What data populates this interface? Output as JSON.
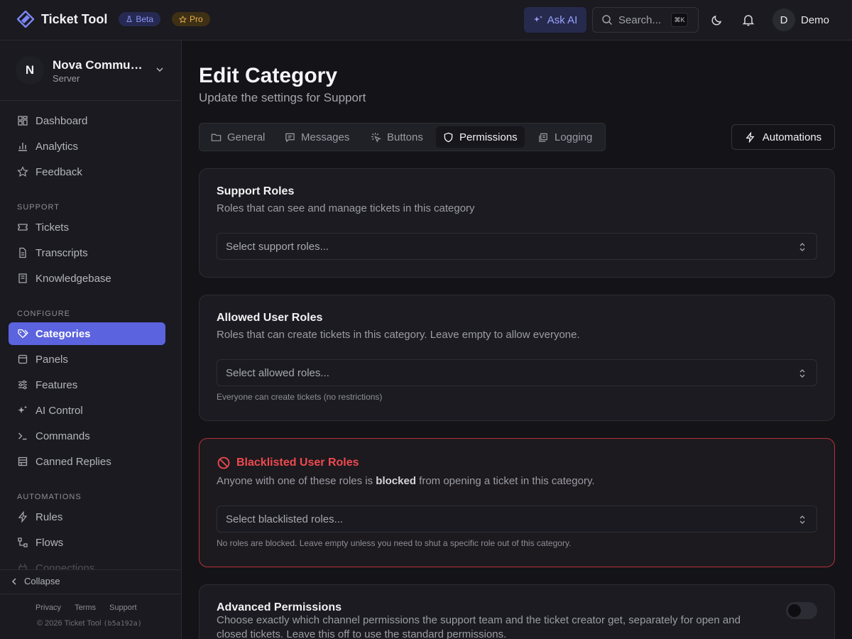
{
  "app": {
    "name": "Ticket Tool",
    "beta_label": "Beta",
    "pro_label": "Pro",
    "ask_ai_label": "Ask AI",
    "search_placeholder": "Search...",
    "search_shortcut": "⌘K",
    "user_initial": "D",
    "user_name": "Demo",
    "accent_color": "#5b63de"
  },
  "server": {
    "initial": "N",
    "name": "Nova Community",
    "subtitle": "Server"
  },
  "sidebar": {
    "items": [
      {
        "label": "Dashboard",
        "icon": "dashboard-icon"
      },
      {
        "label": "Analytics",
        "icon": "chart-icon"
      },
      {
        "label": "Feedback",
        "icon": "star-icon"
      }
    ],
    "support_heading": "SUPPORT",
    "support_items": [
      {
        "label": "Tickets",
        "icon": "ticket-icon"
      },
      {
        "label": "Transcripts",
        "icon": "file-icon"
      },
      {
        "label": "Knowledgebase",
        "icon": "book-icon"
      }
    ],
    "configure_heading": "CONFIGURE",
    "configure_items": [
      {
        "label": "Categories",
        "icon": "tags-icon",
        "active": true
      },
      {
        "label": "Panels",
        "icon": "panel-icon"
      },
      {
        "label": "Features",
        "icon": "sliders-icon"
      },
      {
        "label": "AI Control",
        "icon": "sparkles-icon"
      },
      {
        "label": "Commands",
        "icon": "terminal-icon"
      },
      {
        "label": "Canned Replies",
        "icon": "library-icon"
      }
    ],
    "automations_heading": "AUTOMATIONS",
    "automations_items": [
      {
        "label": "Rules",
        "icon": "bolt-icon"
      },
      {
        "label": "Flows",
        "icon": "flow-icon"
      },
      {
        "label": "Connections",
        "icon": "plug-icon"
      }
    ],
    "collapse_label": "Collapse",
    "footer_links": [
      "Privacy",
      "Terms",
      "Support"
    ],
    "copyright": "© 2026 Ticket Tool",
    "build": "(b5a192a)"
  },
  "page": {
    "title": "Edit Category",
    "subtitle": "Update the settings for Support",
    "tabs": [
      {
        "label": "General",
        "icon": "folder-icon"
      },
      {
        "label": "Messages",
        "icon": "message-icon"
      },
      {
        "label": "Buttons",
        "icon": "pointer-icon"
      },
      {
        "label": "Permissions",
        "icon": "shield-icon",
        "active": true
      },
      {
        "label": "Logging",
        "icon": "log-icon"
      }
    ],
    "automations_button": "Automations"
  },
  "cards": {
    "support_roles": {
      "title": "Support Roles",
      "description": "Roles that can see and manage tickets in this category",
      "placeholder": "Select support roles..."
    },
    "allowed_roles": {
      "title": "Allowed User Roles",
      "description": "Roles that can create tickets in this category. Leave empty to allow everyone.",
      "placeholder": "Select allowed roles...",
      "hint": "Everyone can create tickets (no restrictions)"
    },
    "blacklisted_roles": {
      "title": "Blacklisted User Roles",
      "description_before": "Anyone with one of these roles is ",
      "description_bold": "blocked",
      "description_after": " from opening a ticket in this category.",
      "placeholder": "Select blacklisted roles...",
      "hint": "No roles are blocked. Leave empty unless you need to shut a specific role out of this category.",
      "danger_color": "#ef4a4f"
    },
    "advanced": {
      "title": "Advanced Permissions",
      "description": "Choose exactly which channel permissions the support team and the ticket creator get, separately for open and closed tickets. Leave this off to use the standard permissions.",
      "enabled": false
    }
  }
}
